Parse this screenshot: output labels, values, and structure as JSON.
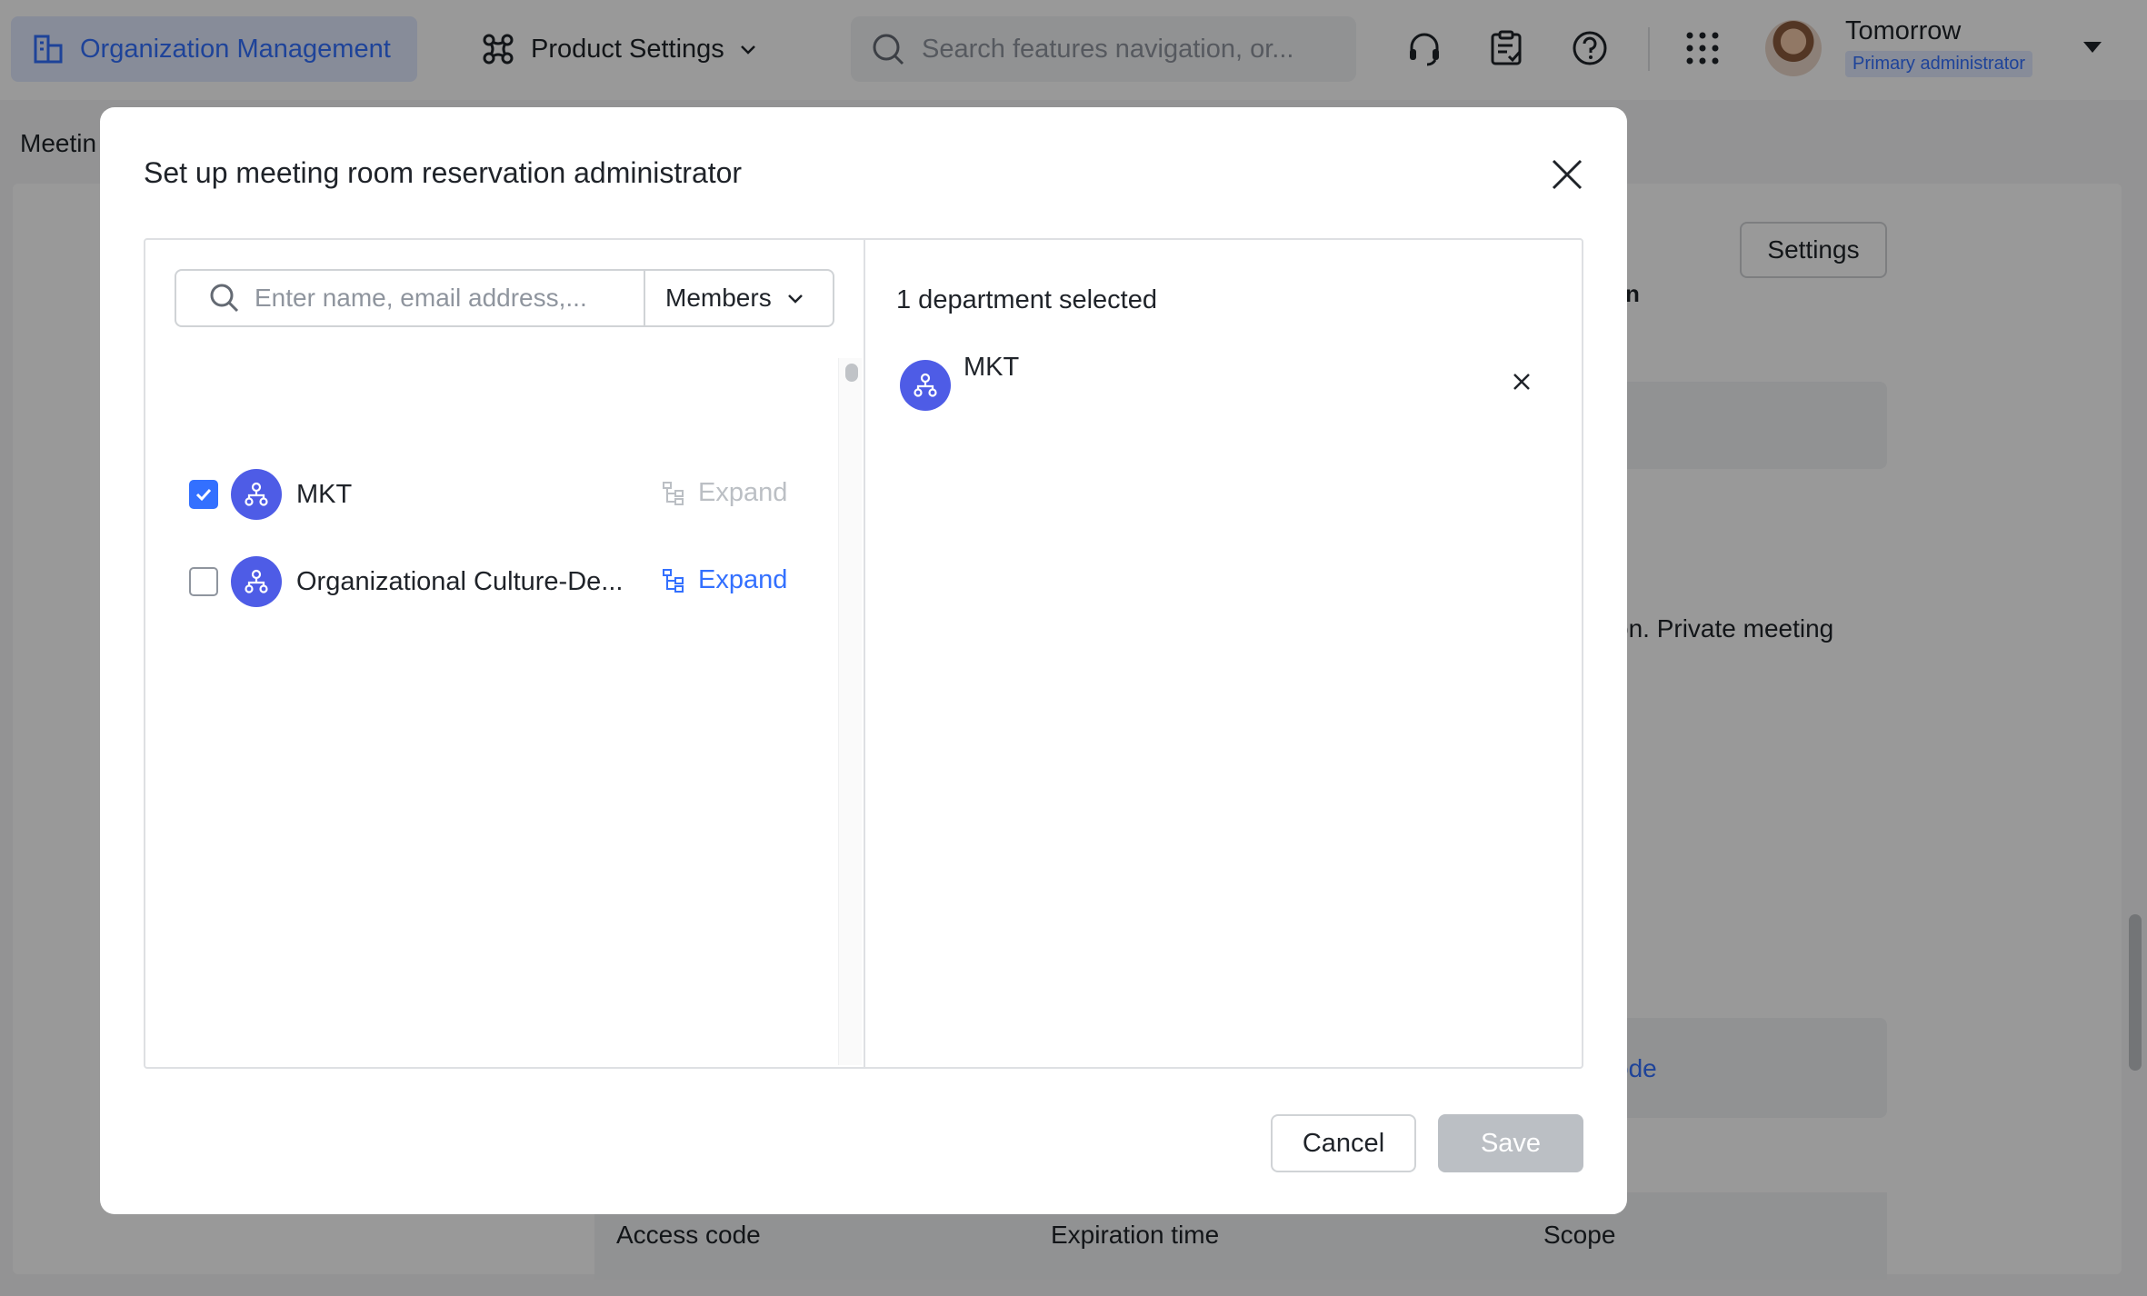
{
  "topbar": {
    "org_tab_label": "Organization Management",
    "product_settings_label": "Product Settings",
    "search_placeholder": "Search features navigation, or...",
    "user": {
      "name": "Tomorrow",
      "role": "Primary administrator"
    }
  },
  "background": {
    "breadcrumb": "Meetin",
    "settings_button": "Settings",
    "heading_fragment": "n",
    "text_fragment": "on. Private meeting",
    "link_fragment": "ode",
    "table_headers": [
      "Access code",
      "Expiration time",
      "Scope"
    ]
  },
  "modal": {
    "title": "Set up meeting room reservation administrator",
    "search_placeholder": "Enter name, email address,...",
    "filter_label": "Members",
    "items": [
      {
        "name": "MKT",
        "checked": true,
        "expand_label": "Expand",
        "expand_enabled": false
      },
      {
        "name": "Organizational Culture-De...",
        "checked": false,
        "expand_label": "Expand",
        "expand_enabled": true
      }
    ],
    "selected_count": "1 department selected",
    "selected": [
      {
        "name": "MKT"
      }
    ],
    "cancel_label": "Cancel",
    "save_label": "Save"
  },
  "colors": {
    "accent": "#3370ff",
    "dept_avatar": "#4e5ce6",
    "save_disabled": "#bbbfc4"
  },
  "icons": {
    "org_tab": "building-icon",
    "product_settings": "product-settings-icon",
    "search": "search-icon",
    "support": "headset-icon",
    "tasks": "clipboard-check-icon",
    "help": "help-icon",
    "apps": "apps-grid-icon",
    "close": "close-icon",
    "department": "department-icon",
    "expand": "org-tree-icon"
  }
}
